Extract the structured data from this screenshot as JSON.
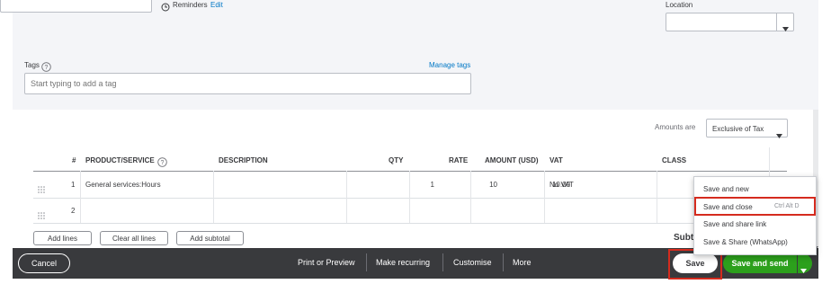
{
  "top": {
    "reminders_label": "Reminders",
    "reminders_edit": "Edit",
    "location_label": "Location",
    "tags_label": "Tags",
    "manage_tags": "Manage tags",
    "tags_placeholder": "Start typing to add a tag",
    "amounts_are_label": "Amounts are",
    "amounts_are_value": "Exclusive of Tax"
  },
  "table": {
    "headers": {
      "num": "#",
      "product": "PRODUCT/SERVICE",
      "description": "DESCRIPTION",
      "qty": "QTY",
      "rate": "RATE",
      "amount": "AMOUNT (USD)",
      "vat": "VAT",
      "class": "CLASS"
    },
    "rows": [
      {
        "num": "1",
        "product": "General services:Hours",
        "description": "",
        "qty": "1",
        "rate": "10",
        "amount": "10.00",
        "vat": "No VAT",
        "class": ""
      },
      {
        "num": "2",
        "product": "",
        "description": "",
        "qty": "",
        "rate": "",
        "amount": "",
        "vat": "",
        "class": ""
      }
    ]
  },
  "line_buttons": {
    "add_lines": "Add lines",
    "clear_all_lines": "Clear all lines",
    "add_subtotal": "Add subtotal"
  },
  "subtotal_label": "Subt",
  "dropdown_menu": {
    "items": [
      {
        "label": "Save and new",
        "shortcut": ""
      },
      {
        "label": "Save and close",
        "shortcut": "Ctrl Alt D"
      },
      {
        "label": "Save and share link",
        "shortcut": ""
      },
      {
        "label": "Save & Share (WhatsApp)",
        "shortcut": ""
      }
    ]
  },
  "footer": {
    "cancel": "Cancel",
    "print_or_preview": "Print or Preview",
    "make_recurring": "Make recurring",
    "customise": "Customise",
    "more": "More",
    "save": "Save",
    "save_and_send": "Save and send"
  },
  "colors": {
    "footer_bg": "#393a3d",
    "primary_green": "#2ca01c",
    "link_blue": "#0077c5",
    "highlight_red": "#d52b1e"
  }
}
